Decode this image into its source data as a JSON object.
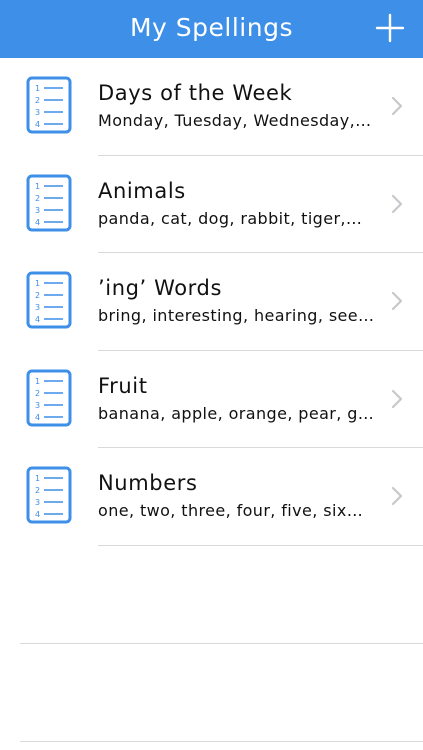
{
  "navbar": {
    "title": "My Spellings",
    "add_icon": "plus-icon",
    "background_color": "#3d8fe8"
  },
  "lists": [
    {
      "title": "Days of the Week",
      "subtitle": "Monday, Tuesday, Wednesday,…",
      "icon": "numbered-list-icon"
    },
    {
      "title": "Animals",
      "subtitle": "panda, cat, dog, rabbit, tiger,…",
      "icon": "numbered-list-icon"
    },
    {
      "title": "’ing’ Words",
      "subtitle": "bring, interesting, hearing, see…",
      "icon": "numbered-list-icon"
    },
    {
      "title": "Fruit",
      "subtitle": "banana, apple, orange, pear, g…",
      "icon": "numbered-list-icon"
    },
    {
      "title": "Numbers",
      "subtitle": "one, two, three, four, five, six…",
      "icon": "numbered-list-icon"
    }
  ],
  "colors": {
    "accent": "#3d8fe8",
    "divider": "#d9d9d9",
    "chevron": "#c7c7cc"
  }
}
